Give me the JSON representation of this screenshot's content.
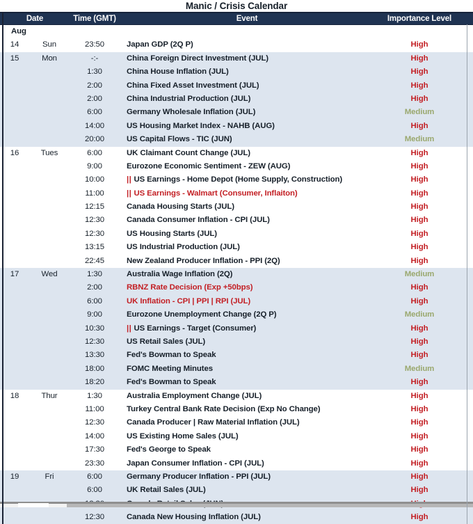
{
  "title": "Manic / Crisis Calendar",
  "colors": {
    "header_bg": "#1f3352",
    "header_text": "#ffffff",
    "row_shade": "#dde5ef",
    "row_plain": "#ffffff",
    "high": "#c32025",
    "medium": "#9aa86e",
    "text": "#17202a"
  },
  "columns": {
    "date": "Date",
    "time": "Time (GMT)",
    "event": "Event",
    "importance": "Importance Level"
  },
  "month_label": "Aug",
  "rows": [
    {
      "day": "Aug",
      "dow": "",
      "time": "",
      "event": "",
      "importance": "",
      "month_header": true,
      "shade": false
    },
    {
      "day": "14",
      "dow": "Sun",
      "time": "23:50",
      "event": "Japan GDP (2Q P)",
      "importance": "High",
      "shade": false
    },
    {
      "day": "15",
      "dow": "Mon",
      "time": "-:-",
      "event": "China Foreign Direct Investment (JUL)",
      "importance": "High",
      "shade": true
    },
    {
      "day": "",
      "dow": "",
      "time": "1:30",
      "event": "China House Inflation (JUL)",
      "importance": "High",
      "shade": true
    },
    {
      "day": "",
      "dow": "",
      "time": "2:00",
      "event": "China Fixed Asset Investment (JUL)",
      "importance": "High",
      "shade": true
    },
    {
      "day": "",
      "dow": "",
      "time": "2:00",
      "event": "China Industrial Production (JUL)",
      "importance": "High",
      "shade": true
    },
    {
      "day": "",
      "dow": "",
      "time": "6:00",
      "event": "Germany Wholesale Inflation (JUL)",
      "importance": "Medium",
      "shade": true
    },
    {
      "day": "",
      "dow": "",
      "time": "14:00",
      "event": "US Housing Market Index - NAHB (AUG)",
      "importance": "High",
      "shade": true
    },
    {
      "day": "",
      "dow": "",
      "time": "20:00",
      "event": "US Capital Flows - TIC (JUN)",
      "importance": "Medium",
      "shade": true
    },
    {
      "day": "16",
      "dow": "Tues",
      "time": "6:00",
      "event": "UK Claimant Count Change (JUL)",
      "importance": "High",
      "shade": false
    },
    {
      "day": "",
      "dow": "",
      "time": "9:00",
      "event": "Eurozone Economic Sentiment - ZEW (AUG)",
      "importance": "High",
      "shade": false
    },
    {
      "day": "",
      "dow": "",
      "time": "10:00",
      "event": "US Earnings - Home Depot (Home Supply, Construction)",
      "mark": "||",
      "importance": "High",
      "shade": false
    },
    {
      "day": "",
      "dow": "",
      "time": "11:00",
      "event": "US Earnings - Walmart (Consumer, Inflaiton)",
      "mark": "||",
      "red": true,
      "importance": "High",
      "shade": false
    },
    {
      "day": "",
      "dow": "",
      "time": "12:15",
      "event": "Canada Housing Starts (JUL)",
      "importance": "High",
      "shade": false
    },
    {
      "day": "",
      "dow": "",
      "time": "12:30",
      "event": "Canada Consumer Inflation - CPI (JUL)",
      "importance": "High",
      "shade": false
    },
    {
      "day": "",
      "dow": "",
      "time": "12:30",
      "event": "US Housing Starts (JUL)",
      "importance": "High",
      "shade": false
    },
    {
      "day": "",
      "dow": "",
      "time": "13:15",
      "event": "US Industrial Production (JUL)",
      "importance": "High",
      "shade": false
    },
    {
      "day": "",
      "dow": "",
      "time": "22:45",
      "event": "New Zealand Producer Inflation - PPI (2Q)",
      "importance": "High",
      "shade": false
    },
    {
      "day": "17",
      "dow": "Wed",
      "time": "1:30",
      "event": "Australia Wage Inflation (2Q)",
      "importance": "Medium",
      "shade": true
    },
    {
      "day": "",
      "dow": "",
      "time": "2:00",
      "event": "RBNZ Rate Decision (Exp +50bps)",
      "red": true,
      "importance": "High",
      "shade": true
    },
    {
      "day": "",
      "dow": "",
      "time": "6:00",
      "event": "UK Inflation - CPI | PPI | RPI (JUL)",
      "red": true,
      "importance": "High",
      "shade": true
    },
    {
      "day": "",
      "dow": "",
      "time": "9:00",
      "event": "Eurozone Unemployment Change (2Q P)",
      "importance": "Medium",
      "shade": true
    },
    {
      "day": "",
      "dow": "",
      "time": "10:30",
      "event": "US Earnings - Target (Consumer)",
      "mark": "||",
      "importance": "High",
      "shade": true
    },
    {
      "day": "",
      "dow": "",
      "time": "12:30",
      "event": "US Retail Sales (JUL)",
      "importance": "High",
      "shade": true
    },
    {
      "day": "",
      "dow": "",
      "time": "13:30",
      "event": "Fed's Bowman to Speak",
      "importance": "High",
      "shade": true
    },
    {
      "day": "",
      "dow": "",
      "time": "18:00",
      "event": "FOMC Meeting Minutes",
      "importance": "Medium",
      "shade": true
    },
    {
      "day": "",
      "dow": "",
      "time": "18:20",
      "event": "Fed's Bowman to Speak",
      "importance": "High",
      "shade": true
    },
    {
      "day": "18",
      "dow": "Thur",
      "time": "1:30",
      "event": "Australia Employment Change (JUL)",
      "importance": "High",
      "shade": false
    },
    {
      "day": "",
      "dow": "",
      "time": "11:00",
      "event": "Turkey Central Bank Rate Decision (Exp No Change)",
      "importance": "High",
      "shade": false
    },
    {
      "day": "",
      "dow": "",
      "time": "12:30",
      "event": "Canada Producer | Raw Material Inflation (JUL)",
      "importance": "High",
      "shade": false
    },
    {
      "day": "",
      "dow": "",
      "time": "14:00",
      "event": "US Existing Home Sales (JUL)",
      "importance": "High",
      "shade": false
    },
    {
      "day": "",
      "dow": "",
      "time": "17:30",
      "event": "Fed's George to Speak",
      "importance": "High",
      "shade": false
    },
    {
      "day": "",
      "dow": "",
      "time": "23:30",
      "event": "Japan Consumer Inflation - CPI (JUL)",
      "importance": "High",
      "shade": false
    },
    {
      "day": "19",
      "dow": "Fri",
      "time": "6:00",
      "event": "Germany Producer Inflation - PPI (JUL)",
      "importance": "High",
      "shade": true
    },
    {
      "day": "",
      "dow": "",
      "time": "6:00",
      "event": "UK Retail Sales (JUL)",
      "importance": "High",
      "shade": true
    },
    {
      "day": "",
      "dow": "",
      "time": "12:30",
      "event": "Canada Retail Sales (JUN)",
      "importance": "High",
      "shade": true
    },
    {
      "day": "",
      "dow": "",
      "time": "12:30",
      "event": "Canada New Housing Inflation (JUL)",
      "importance": "High",
      "shade": true
    }
  ]
}
